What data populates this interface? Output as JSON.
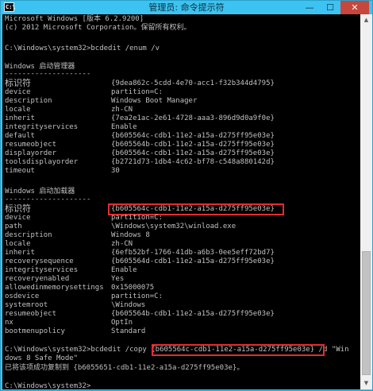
{
  "window": {
    "title": "管理员: 命令提示符",
    "icon_text": "C:\\",
    "minimize": "—",
    "maximize": "☐",
    "close": "✕"
  },
  "console": {
    "version_line": "Microsoft Windows [版本 6.2.9200]",
    "copyright_line": "(c) 2012 Microsoft Corporation。保留所有权利。",
    "command1": "C:\\Windows\\system32>bcdedit /enum /v",
    "section1": {
      "title": "Windows 启动管理器",
      "divider": "--------------------",
      "id_label": "标识符",
      "id_value": "{9dea862c-5cdd-4e70-acc1-f32b344d4795}",
      "entries": [
        {
          "key": "device",
          "value": "partition=C:"
        },
        {
          "key": "description",
          "value": "Windows Boot Manager"
        },
        {
          "key": "locale",
          "value": "zh-CN"
        },
        {
          "key": "inherit",
          "value": "{7ea2e1ac-2e61-4728-aaa3-896d9d0a9f0e}"
        },
        {
          "key": "integrityservices",
          "value": "Enable"
        },
        {
          "key": "default",
          "value": "{b605564c-cdb1-11e2-a15a-d275ff95e03e}"
        },
        {
          "key": "resumeobject",
          "value": "{b605564b-cdb1-11e2-a15a-d275ff95e03e}"
        },
        {
          "key": "displayorder",
          "value": "{b605564c-cdb1-11e2-a15a-d275ff95e03e}"
        },
        {
          "key": "toolsdisplayorder",
          "value": "{b2721d73-1db4-4c62-bf78-c548a880142d}"
        },
        {
          "key": "timeout",
          "value": "30"
        }
      ]
    },
    "section2": {
      "title": "Windows 启动加载器",
      "divider": "--------------------",
      "id_label": "标识符",
      "id_value": "{b605564c-cdb1-11e2-a15a-d275ff95e03e}",
      "entries": [
        {
          "key": "device",
          "value": "partition=C:"
        },
        {
          "key": "path",
          "value": "\\Windows\\system32\\winload.exe"
        },
        {
          "key": "description",
          "value": "Windows 8"
        },
        {
          "key": "locale",
          "value": "zh-CN"
        },
        {
          "key": "inherit",
          "value": "{6efb52bf-1766-41db-a6b3-0ee5eff72bd7}"
        },
        {
          "key": "recoverysequence",
          "value": "{b605564d-cdb1-11e2-a15a-d275ff95e03e}"
        },
        {
          "key": "integrityservices",
          "value": "Enable"
        },
        {
          "key": "recoveryenabled",
          "value": "Yes"
        },
        {
          "key": "allowedinmemorysettings",
          "value": "0x15000075"
        },
        {
          "key": "osdevice",
          "value": "partition=C:"
        },
        {
          "key": "systemroot",
          "value": "\\Windows"
        },
        {
          "key": "resumeobject",
          "value": "{b605564b-cdb1-11e2-a15a-d275ff95e03e}"
        },
        {
          "key": "nx",
          "value": "OptIn"
        },
        {
          "key": "bootmenupolicy",
          "value": "Standard"
        }
      ]
    },
    "command2_prefix": "C:\\Windows\\system32>bcdedit /copy ",
    "command2_guid": "{b605564c-cdb1-11e2-a15a-d275ff95e03e}",
    "command2_suffix": " /d \"Win",
    "command2_wrap": "dows 8 Safe Mode\"",
    "result_line": "已将该项成功复制到 {b6055651-cdb1-11e2-a15a-d275ff95e03e}。",
    "prompt": "C:\\Windows\\system32>"
  },
  "scrollbar": {
    "up_arrow": "▲",
    "down_arrow": "▼"
  }
}
